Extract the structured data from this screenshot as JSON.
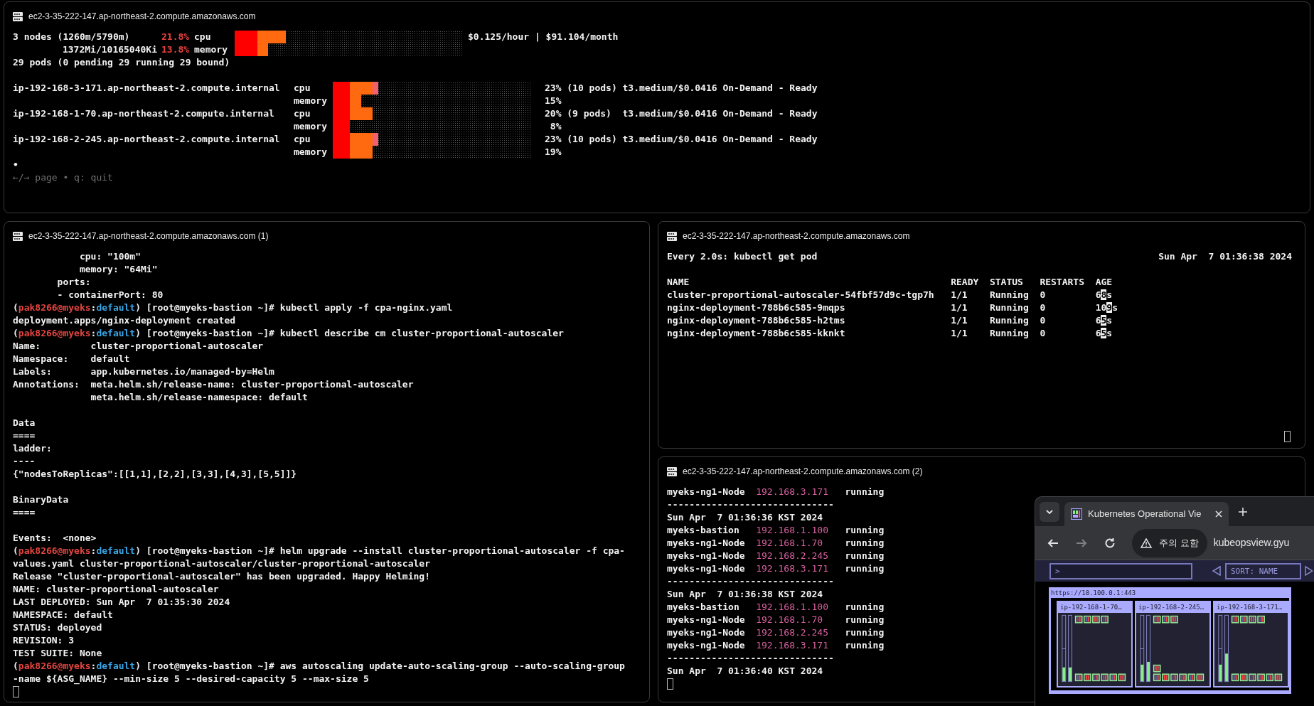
{
  "top_terminal": {
    "title": "ec2-3-35-222-147.ap-northeast-2.compute.amazonaws.com",
    "cluster": {
      "rows": [
        {
          "summary": "3 nodes (1260m/5790m)",
          "percent": "21.8%",
          "resource": "cpu",
          "bar": {
            "segments": [
              {
                "kind": "used",
                "level": 0.1
              },
              {
                "kind": "requested",
                "level": 0.224
              }
            ]
          }
        },
        {
          "summary": "1372Mi/10165040Ki",
          "percent": "13.8%",
          "resource": "memory",
          "bar": {
            "segments": [
              {
                "kind": "used",
                "level": 0.1
              },
              {
                "kind": "requested",
                "level": 0.147
              }
            ]
          }
        }
      ],
      "cost": "$0.125/hour | $91.104/month",
      "pods": "29 pods (0 pending 29 running 29 bound)"
    },
    "nodes": [
      {
        "name": "ip-192-168-3-171.ap-northeast-2.compute.internal",
        "info": "t3.medium/$0.0416 On-Demand - Ready",
        "rows": [
          {
            "resource": "cpu",
            "percent": "23%",
            "pods": "(10 pods)",
            "bar": {
              "segments": [
                {
                  "kind": "used",
                  "level": 0.085
                },
                {
                  "kind": "requested",
                  "level": 0.2
                },
                {
                  "kind": "limit",
                  "level": 0.228
                }
              ]
            }
          },
          {
            "resource": "memory",
            "percent": "15%",
            "bar": {
              "segments": [
                {
                  "kind": "used",
                  "level": 0.085
                },
                {
                  "kind": "requested",
                  "level": 0.143
                }
              ]
            }
          }
        ]
      },
      {
        "name": "ip-192-168-1-70.ap-northeast-2.compute.internal",
        "info": "t3.medium/$0.0416 On-Demand - Ready",
        "rows": [
          {
            "resource": "cpu",
            "percent": "20%",
            "pods": "(9 pods)",
            "bar": {
              "segments": [
                {
                  "kind": "used",
                  "level": 0.085
                },
                {
                  "kind": "requested",
                  "level": 0.2
                }
              ]
            }
          },
          {
            "resource": "memory",
            "percent": "8%",
            "bar": {
              "segments": [
                {
                  "kind": "used",
                  "level": 0.085
                }
              ]
            }
          }
        ]
      },
      {
        "name": "ip-192-168-2-245.ap-northeast-2.compute.internal",
        "info": "t3.medium/$0.0416 On-Demand - Ready",
        "rows": [
          {
            "resource": "cpu",
            "percent": "23%",
            "pods": "(10 pods)",
            "bar": {
              "segments": [
                {
                  "kind": "used",
                  "level": 0.085
                },
                {
                  "kind": "requested",
                  "level": 0.2
                },
                {
                  "kind": "limit",
                  "level": 0.228
                }
              ]
            }
          },
          {
            "resource": "memory",
            "percent": "19%",
            "bar": {
              "segments": [
                {
                  "kind": "used",
                  "level": 0.085
                },
                {
                  "kind": "requested",
                  "level": 0.2
                }
              ]
            }
          }
        ]
      }
    ],
    "bullet": "•",
    "footer": "←/→ page • q: quit"
  },
  "left_terminal": {
    "title": "ec2-3-35-222-147.ap-northeast-2.compute.amazonaws.com (1)",
    "lines": [
      {
        "kind": "output",
        "text": "            cpu: \"100m\""
      },
      {
        "kind": "output",
        "text": "            memory: \"64Mi\""
      },
      {
        "kind": "output",
        "text": "        ports:"
      },
      {
        "kind": "output",
        "text": "        - containerPort: 80"
      },
      {
        "kind": "prompt",
        "segments": [
          {
            "kind": "plain",
            "text": "("
          },
          {
            "kind": "user",
            "text": "pak8266@myeks"
          },
          {
            "kind": "plain",
            "text": ":"
          },
          {
            "kind": "namespace",
            "text": "default"
          },
          {
            "kind": "plain",
            "text": ") [root@myeks-bastion ~]# kubectl apply -f cpa-nginx.yaml"
          }
        ]
      },
      {
        "kind": "output",
        "text": "deployment.apps/nginx-deployment created"
      },
      {
        "kind": "prompt",
        "segments": [
          {
            "kind": "plain",
            "text": "("
          },
          {
            "kind": "user",
            "text": "pak8266@myeks"
          },
          {
            "kind": "plain",
            "text": ":"
          },
          {
            "kind": "namespace",
            "text": "default"
          },
          {
            "kind": "plain",
            "text": ") [root@myeks-bastion ~]# kubectl describe cm cluster-proportional-autoscaler"
          }
        ]
      },
      {
        "kind": "output",
        "text": "Name:         cluster-proportional-autoscaler"
      },
      {
        "kind": "output",
        "text": "Namespace:    default"
      },
      {
        "kind": "output",
        "text": "Labels:       app.kubernetes.io/managed-by=Helm"
      },
      {
        "kind": "output",
        "text": "Annotations:  meta.helm.sh/release-name: cluster-proportional-autoscaler"
      },
      {
        "kind": "output",
        "text": "              meta.helm.sh/release-namespace: default"
      },
      {
        "kind": "blank"
      },
      {
        "kind": "output",
        "text": "Data"
      },
      {
        "kind": "output",
        "text": "===="
      },
      {
        "kind": "output",
        "text": "ladder:"
      },
      {
        "kind": "output",
        "text": "----"
      },
      {
        "kind": "output",
        "text": "{\"nodesToReplicas\":[[1,1],[2,2],[3,3],[4,3],[5,5]]}"
      },
      {
        "kind": "blank"
      },
      {
        "kind": "output",
        "text": "BinaryData"
      },
      {
        "kind": "output",
        "text": "===="
      },
      {
        "kind": "blank"
      },
      {
        "kind": "output",
        "text": "Events:  <none>"
      },
      {
        "kind": "prompt",
        "segments": [
          {
            "kind": "plain",
            "text": "("
          },
          {
            "kind": "user",
            "text": "pak8266@myeks"
          },
          {
            "kind": "plain",
            "text": ":"
          },
          {
            "kind": "namespace",
            "text": "default"
          },
          {
            "kind": "plain",
            "text": ") [root@myeks-bastion ~]# helm upgrade --install cluster-proportional-autoscaler -f cpa-"
          }
        ]
      },
      {
        "kind": "output",
        "text": "values.yaml cluster-proportional-autoscaler/cluster-proportional-autoscaler"
      },
      {
        "kind": "output",
        "text": "Release \"cluster-proportional-autoscaler\" has been upgraded. Happy Helming!"
      },
      {
        "kind": "output",
        "text": "NAME: cluster-proportional-autoscaler"
      },
      {
        "kind": "output",
        "text": "LAST DEPLOYED: Sun Apr  7 01:35:30 2024"
      },
      {
        "kind": "output",
        "text": "NAMESPACE: default"
      },
      {
        "kind": "output",
        "text": "STATUS: deployed"
      },
      {
        "kind": "output",
        "text": "REVISION: 3"
      },
      {
        "kind": "output",
        "text": "TEST SUITE: None"
      },
      {
        "kind": "prompt",
        "segments": [
          {
            "kind": "plain",
            "text": "("
          },
          {
            "kind": "user",
            "text": "pak8266@myeks"
          },
          {
            "kind": "plain",
            "text": ":"
          },
          {
            "kind": "namespace",
            "text": "default"
          },
          {
            "kind": "plain",
            "text": ") [root@myeks-bastion ~]# aws autoscaling update-auto-scaling-group --auto-scaling-group"
          }
        ]
      },
      {
        "kind": "output",
        "text": "-name ${ASG_NAME} --min-size 5 --desired-capacity 5 --max-size 5"
      },
      {
        "kind": "cursor"
      }
    ]
  },
  "pods_terminal": {
    "title": "ec2-3-35-222-147.ap-northeast-2.compute.amazonaws.com",
    "command": "Every 2.0s: kubectl get pod",
    "timestamp": "Sun Apr  7 01:36:38 2024",
    "columns": [
      "NAME",
      "READY",
      "STATUS",
      "RESTARTS",
      "AGE"
    ],
    "rows": [
      {
        "name": "cluster-proportional-autoscaler-54fbf57d9c-tgp7h",
        "ready": "1/1",
        "status": "Running",
        "restarts": "0",
        "age": [
          {
            "text": "6",
            "highlighted": false
          },
          {
            "text": "8",
            "highlighted": true
          },
          {
            "text": "s",
            "highlighted": false
          }
        ]
      },
      {
        "name": "nginx-deployment-788b6c585-9mqps",
        "ready": "1/1",
        "status": "Running",
        "restarts": "0",
        "age": [
          {
            "text": "10",
            "highlighted": false
          },
          {
            "text": "9",
            "highlighted": true
          },
          {
            "text": "s",
            "highlighted": false
          }
        ]
      },
      {
        "name": "nginx-deployment-788b6c585-h2tms",
        "ready": "1/1",
        "status": "Running",
        "restarts": "0",
        "age": [
          {
            "text": "6",
            "highlighted": false
          },
          {
            "text": "5",
            "highlighted": true
          },
          {
            "text": "s",
            "highlighted": false
          }
        ]
      },
      {
        "name": "nginx-deployment-788b6c585-kknkt",
        "ready": "1/1",
        "status": "Running",
        "restarts": "0",
        "age": [
          {
            "text": "6",
            "highlighted": false
          },
          {
            "text": "5",
            "highlighted": true
          },
          {
            "text": "s",
            "highlighted": false
          }
        ]
      }
    ]
  },
  "hosts_terminal": {
    "title": "ec2-3-35-222-147.ap-northeast-2.compute.amazonaws.com (2)",
    "lines": [
      {
        "kind": "host",
        "name": "myeks-ng1-Node",
        "ip": "192.168.3.171",
        "state": "running"
      },
      {
        "kind": "separator",
        "text": "------------------------------"
      },
      {
        "kind": "date",
        "text": "Sun Apr  7 01:36:36 KST 2024"
      },
      {
        "kind": "host",
        "name": "myeks-bastion",
        "ip": "192.168.1.100",
        "state": "running"
      },
      {
        "kind": "host",
        "name": "myeks-ng1-Node",
        "ip": "192.168.1.70",
        "state": "running"
      },
      {
        "kind": "host",
        "name": "myeks-ng1-Node",
        "ip": "192.168.2.245",
        "state": "running"
      },
      {
        "kind": "host",
        "name": "myeks-ng1-Node",
        "ip": "192.168.3.171",
        "state": "running"
      },
      {
        "kind": "separator",
        "text": "------------------------------"
      },
      {
        "kind": "date",
        "text": "Sun Apr  7 01:36:38 KST 2024"
      },
      {
        "kind": "host",
        "name": "myeks-bastion",
        "ip": "192.168.1.100",
        "state": "running"
      },
      {
        "kind": "host",
        "name": "myeks-ng1-Node",
        "ip": "192.168.1.70",
        "state": "running"
      },
      {
        "kind": "host",
        "name": "myeks-ng1-Node",
        "ip": "192.168.2.245",
        "state": "running"
      },
      {
        "kind": "host",
        "name": "myeks-ng1-Node",
        "ip": "192.168.3.171",
        "state": "running"
      },
      {
        "kind": "separator",
        "text": "------------------------------"
      },
      {
        "kind": "date",
        "text": "Sun Apr  7 01:36:40 KST 2024"
      },
      {
        "kind": "cursor"
      }
    ]
  },
  "browser": {
    "tab_title": "Kubernetes Operational Vie",
    "nav": [
      {
        "kind": "back",
        "disabled": false
      },
      {
        "kind": "forward",
        "disabled": true
      },
      {
        "kind": "reload",
        "disabled": false
      }
    ],
    "security_label": "주의 요함",
    "url": "kubeopsview.gyu",
    "page": {
      "filter_prompt": ">",
      "sort_label": "SORT: NAME",
      "cluster": {
        "url": "https://10.100.0.1:443",
        "nodes": [
          {
            "name": "ip-192-168-1-70…"
          },
          {
            "name": "ip-192-168-2-245…"
          },
          {
            "name": "ip-192-168-3-171…"
          }
        ]
      }
    }
  }
}
